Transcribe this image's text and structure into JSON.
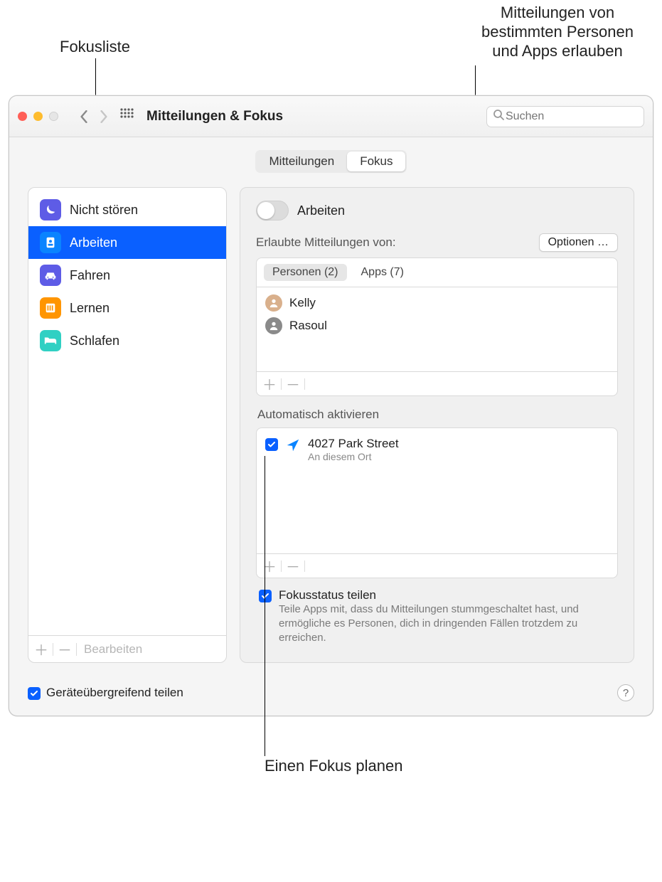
{
  "callouts": {
    "focuslist": "Fokusliste",
    "allow": "Mitteilungen von\nbestimmten Personen\nund Apps erlauben",
    "plan": "Einen Fokus planen"
  },
  "toolbar": {
    "title": "Mitteilungen & Fokus",
    "search_placeholder": "Suchen"
  },
  "tabs": {
    "notifications": "Mitteilungen",
    "focus": "Fokus"
  },
  "sidebar": {
    "items": [
      {
        "label": "Nicht stören",
        "color": "#5e5ce6",
        "icon": "moon"
      },
      {
        "label": "Arbeiten",
        "color": "#0a84ff",
        "icon": "badge",
        "selected": true
      },
      {
        "label": "Fahren",
        "color": "#5e5ce6",
        "icon": "car"
      },
      {
        "label": "Lernen",
        "color": "#ff9500",
        "icon": "book"
      },
      {
        "label": "Schlafen",
        "color": "#30d0c3",
        "icon": "bed"
      }
    ],
    "footer": {
      "edit": "Bearbeiten"
    }
  },
  "main": {
    "focus_name": "Arbeiten",
    "allowed_label": "Erlaubte Mitteilungen von:",
    "options_button": "Optionen …",
    "allowed_tabs": {
      "people": "Personen (2)",
      "apps": "Apps (7)"
    },
    "people": [
      "Kelly",
      "Rasoul"
    ],
    "auto_label": "Automatisch aktivieren",
    "auto_item": {
      "title": "4027 Park Street",
      "subtitle": "An diesem Ort"
    },
    "share_status": {
      "title": "Fokusstatus teilen",
      "desc": "Teile Apps mit, dass du Mitteilungen stummgeschaltet hast, und ermögliche es Personen, dich in dringenden Fällen trotzdem zu erreichen."
    }
  },
  "bottom": {
    "share_devices": "Geräteübergreifend teilen"
  }
}
